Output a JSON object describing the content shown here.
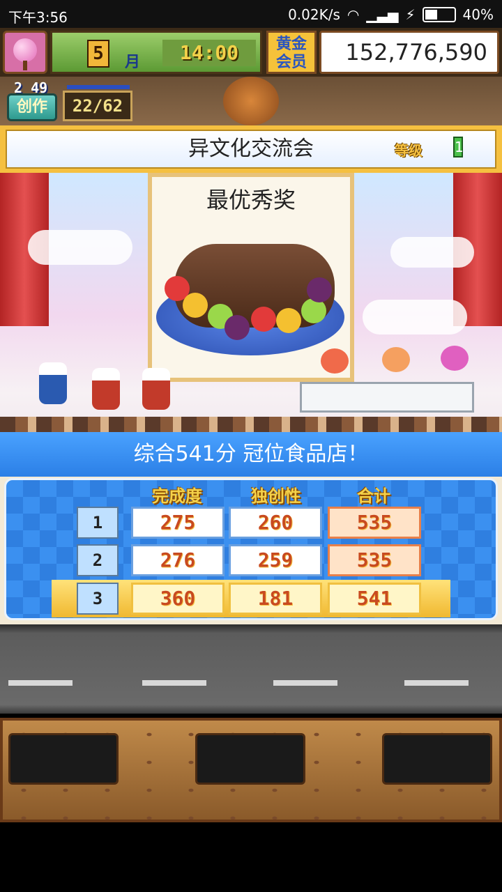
{
  "status_bar": {
    "time": "下午3:56",
    "network_speed": "0.02K/s",
    "battery": "40%"
  },
  "hud": {
    "month_number": "5",
    "month_unit": "月",
    "clock": "14:00",
    "gold_member_line1": "黄金",
    "gold_member_line2": "会员",
    "money": "152,776,590 G"
  },
  "creation": {
    "timer": "2 49",
    "label": "创作",
    "count": "22/62"
  },
  "event": {
    "title": "异文化交流会",
    "grade_label": "等级",
    "grade_value": "1"
  },
  "award": {
    "title": "最优秀奖"
  },
  "result": {
    "summary": "综合541分 冠位食品店！",
    "columns": [
      "完成度",
      "独创性",
      "合计"
    ],
    "rows": [
      {
        "rank": "1",
        "completion": "275",
        "originality": "260",
        "total": "535"
      },
      {
        "rank": "2",
        "completion": "276",
        "originality": "259",
        "total": "535"
      },
      {
        "rank": "3",
        "completion": "360",
        "originality": "181",
        "total": "541"
      }
    ]
  },
  "colors": {
    "summary_bg": "#3b90f0",
    "highlight_row": "#f0b830",
    "score_text": "#c84a20"
  }
}
